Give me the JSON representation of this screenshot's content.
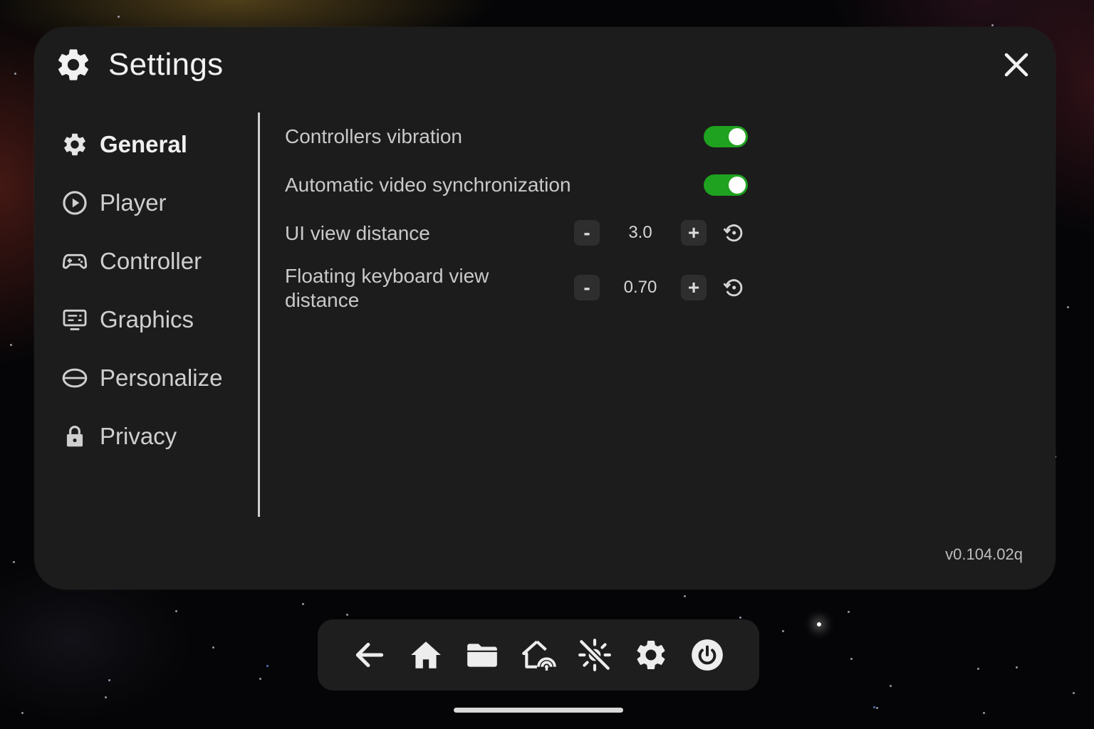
{
  "window": {
    "title": "Settings",
    "close_icon": "close-icon"
  },
  "sidebar": {
    "items": [
      {
        "label": "General",
        "icon": "gear-icon",
        "active": true
      },
      {
        "label": "Player",
        "icon": "play-circle-icon",
        "active": false
      },
      {
        "label": "Controller",
        "icon": "gamepad-icon",
        "active": false
      },
      {
        "label": "Graphics",
        "icon": "monitor-icon",
        "active": false
      },
      {
        "label": "Personalize",
        "icon": "vr-headset-icon",
        "active": false
      },
      {
        "label": "Privacy",
        "icon": "lock-icon",
        "active": false
      }
    ]
  },
  "general": {
    "controllers_vibration": {
      "label": "Controllers vibration",
      "enabled": true
    },
    "auto_video_sync": {
      "label": "Automatic video synchronization",
      "enabled": true
    },
    "ui_view_distance": {
      "label": "UI view distance",
      "value": "3.0",
      "decrement": "-",
      "increment": "+"
    },
    "keyboard_view_distance": {
      "label": "Floating keyboard view distance",
      "value": "0.70",
      "decrement": "-",
      "increment": "+"
    }
  },
  "version": "v0.104.02q",
  "dock": {
    "items": [
      "back-arrow-icon",
      "home-icon",
      "folder-icon",
      "home-network-icon",
      "passthrough-off-icon",
      "gear-icon",
      "power-icon"
    ]
  },
  "colors": {
    "toggle_on": "#1fa21f",
    "panel": "#1c1c1c",
    "dock": "#1e1e1e"
  }
}
